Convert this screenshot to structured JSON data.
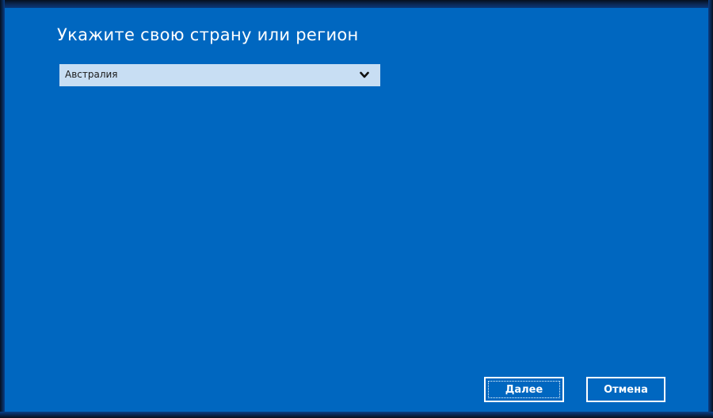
{
  "page": {
    "title": "Укажите свою страну или регион"
  },
  "region_select": {
    "selected_value": "Австралия",
    "icon": "chevron-down-icon"
  },
  "actions": {
    "next_label": "Далее",
    "cancel_label": "Отмена"
  },
  "colors": {
    "background": "#0067c0",
    "select_background": "#c8def3",
    "text": "#ffffff"
  }
}
